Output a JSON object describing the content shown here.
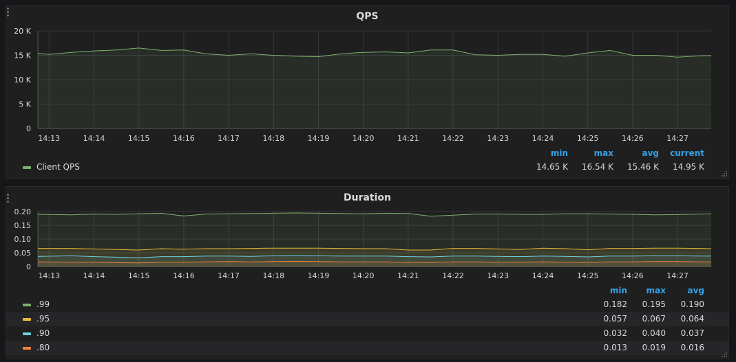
{
  "panels": [
    {
      "title": "QPS",
      "legend_headers": [
        "min",
        "max",
        "avg",
        "current"
      ],
      "legend": [
        {
          "name": "Client QPS",
          "color": "#7eb26d",
          "values": [
            "14.65 K",
            "16.54 K",
            "15.46 K",
            "14.95 K"
          ]
        }
      ]
    },
    {
      "title": "Duration",
      "legend_headers": [
        "min",
        "max",
        "avg"
      ],
      "legend": [
        {
          "name": ".99",
          "color": "#7eb26d",
          "values": [
            "0.182",
            "0.195",
            "0.190"
          ]
        },
        {
          "name": ".95",
          "color": "#eab839",
          "values": [
            "0.057",
            "0.067",
            "0.064"
          ]
        },
        {
          "name": ".90",
          "color": "#6ed0e0",
          "values": [
            "0.032",
            "0.040",
            "0.037"
          ]
        },
        {
          "name": ".80",
          "color": "#ef843c",
          "values": [
            "0.013",
            "0.019",
            "0.016"
          ]
        }
      ]
    }
  ],
  "chart_data": [
    {
      "type": "area",
      "title": "QPS",
      "x_ticks": [
        "14:13",
        "14:14",
        "14:15",
        "14:16",
        "14:17",
        "14:18",
        "14:19",
        "14:20",
        "14:21",
        "14:22",
        "14:23",
        "14:24",
        "14:25",
        "14:26",
        "14:27"
      ],
      "y_ticks": [
        "0",
        "5 K",
        "10 K",
        "15 K",
        "20 K"
      ],
      "ylim": [
        0,
        20000
      ],
      "xlim": [
        -0.25,
        14.75
      ],
      "grid": true,
      "series": [
        {
          "name": "Client QPS",
          "color": "#7eb26d",
          "x": [
            -0.25,
            0,
            0.5,
            1,
            1.5,
            2,
            2.5,
            3,
            3.5,
            4,
            4.5,
            5,
            5.5,
            6,
            6.5,
            7,
            7.5,
            8,
            8.5,
            9,
            9.5,
            10,
            10.5,
            11,
            11.5,
            12,
            12.5,
            13,
            13.5,
            14,
            14.5,
            14.75
          ],
          "y": [
            15400,
            15200,
            15600,
            15900,
            16100,
            16500,
            16000,
            16100,
            15300,
            15000,
            15300,
            15000,
            14800,
            14700,
            15300,
            15600,
            15700,
            15500,
            16100,
            16100,
            15100,
            15000,
            15200,
            15200,
            14800,
            15500,
            16000,
            15000,
            15000,
            14600,
            14900,
            14950
          ]
        }
      ]
    },
    {
      "type": "area",
      "title": "Duration",
      "x_ticks": [
        "14:13",
        "14:14",
        "14:15",
        "14:16",
        "14:17",
        "14:18",
        "14:19",
        "14:20",
        "14:21",
        "14:22",
        "14:23",
        "14:24",
        "14:25",
        "14:26",
        "14:27"
      ],
      "y_ticks": [
        "0",
        "0.05",
        "0.10",
        "0.15",
        "0.20"
      ],
      "ylim": [
        0,
        0.2
      ],
      "xlim": [
        -0.25,
        14.75
      ],
      "grid": true,
      "series": [
        {
          "name": ".99",
          "color": "#7eb26d",
          "x": [
            -0.25,
            0.5,
            1,
            1.5,
            2,
            2.5,
            3,
            3.5,
            4,
            4.5,
            5,
            5.5,
            6,
            6.5,
            7,
            7.5,
            8,
            8.5,
            9,
            9.5,
            10,
            10.5,
            11,
            11.5,
            12,
            12.5,
            13,
            13.5,
            14,
            14.5,
            14.75
          ],
          "y": [
            0.19,
            0.188,
            0.191,
            0.19,
            0.192,
            0.194,
            0.184,
            0.191,
            0.192,
            0.193,
            0.194,
            0.195,
            0.194,
            0.193,
            0.192,
            0.194,
            0.193,
            0.183,
            0.187,
            0.191,
            0.191,
            0.19,
            0.19,
            0.192,
            0.192,
            0.191,
            0.19,
            0.188,
            0.189,
            0.191,
            0.192
          ]
        },
        {
          "name": ".95",
          "color": "#eab839",
          "x": [
            -0.25,
            0.5,
            1,
            1.5,
            2,
            2.5,
            3,
            3.5,
            4,
            4.5,
            5,
            5.5,
            6,
            6.5,
            7,
            7.5,
            8,
            8.5,
            9,
            9.5,
            10,
            10.5,
            11,
            11.5,
            12,
            12.5,
            13,
            13.5,
            14,
            14.5,
            14.75
          ],
          "y": [
            0.066,
            0.066,
            0.064,
            0.062,
            0.06,
            0.065,
            0.063,
            0.065,
            0.065,
            0.066,
            0.067,
            0.067,
            0.067,
            0.066,
            0.065,
            0.065,
            0.06,
            0.06,
            0.066,
            0.066,
            0.064,
            0.062,
            0.067,
            0.065,
            0.061,
            0.066,
            0.066,
            0.067,
            0.067,
            0.066,
            0.065
          ]
        },
        {
          "name": ".90",
          "color": "#6ed0e0",
          "x": [
            -0.25,
            0.5,
            1,
            1.5,
            2,
            2.5,
            3,
            3.5,
            4,
            4.5,
            5,
            5.5,
            6,
            6.5,
            7,
            7.5,
            8,
            8.5,
            9,
            9.5,
            10,
            10.5,
            11,
            11.5,
            12,
            12.5,
            13,
            13.5,
            14,
            14.5,
            14.75
          ],
          "y": [
            0.037,
            0.039,
            0.036,
            0.034,
            0.032,
            0.036,
            0.036,
            0.038,
            0.038,
            0.037,
            0.039,
            0.04,
            0.039,
            0.038,
            0.038,
            0.038,
            0.036,
            0.035,
            0.038,
            0.038,
            0.037,
            0.036,
            0.038,
            0.037,
            0.035,
            0.038,
            0.038,
            0.039,
            0.039,
            0.038,
            0.038
          ]
        },
        {
          "name": ".80",
          "color": "#ef843c",
          "x": [
            -0.25,
            0.5,
            1,
            1.5,
            2,
            2.5,
            3,
            3.5,
            4,
            4.5,
            5,
            5.5,
            6,
            6.5,
            7,
            7.5,
            8,
            8.5,
            9,
            9.5,
            10,
            10.5,
            11,
            11.5,
            12,
            12.5,
            13,
            13.5,
            14,
            14.5,
            14.75
          ],
          "y": [
            0.017,
            0.016,
            0.016,
            0.014,
            0.013,
            0.016,
            0.016,
            0.017,
            0.018,
            0.017,
            0.018,
            0.019,
            0.018,
            0.017,
            0.017,
            0.017,
            0.015,
            0.015,
            0.017,
            0.017,
            0.016,
            0.016,
            0.017,
            0.016,
            0.015,
            0.017,
            0.017,
            0.018,
            0.018,
            0.017,
            0.017
          ]
        }
      ]
    }
  ]
}
